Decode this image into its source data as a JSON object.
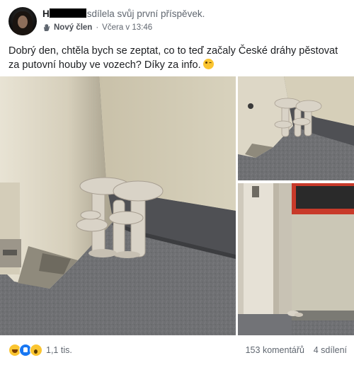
{
  "post": {
    "author_initial": "H",
    "action": "sdílela svůj první příspěvek.",
    "badge_icon": "wave-hand-icon",
    "badge_label": "Nový člen",
    "timestamp": "Včera v 13:46",
    "text": "Dobrý den, chtěla bych se zeptat, co to teď začaly České dráhy pěstovat za putovní houby ve vozech? Díky za info.",
    "text_emoji": "wink-emoji"
  },
  "photos": [
    {
      "name": "mushrooms-closeup-photo"
    },
    {
      "name": "mushrooms-corner-photo"
    },
    {
      "name": "train-door-floor-photo"
    }
  ],
  "footer": {
    "reaction_icons": [
      "haha-icon",
      "like-icon",
      "wow-icon"
    ],
    "reaction_count": "1,1 tis.",
    "comments": "153 komentářů",
    "shares": "4 sdílení"
  },
  "colors": {
    "like_blue": "#1877f2",
    "emoji_yellow": "#fbc531",
    "meta_gray": "#606770"
  }
}
